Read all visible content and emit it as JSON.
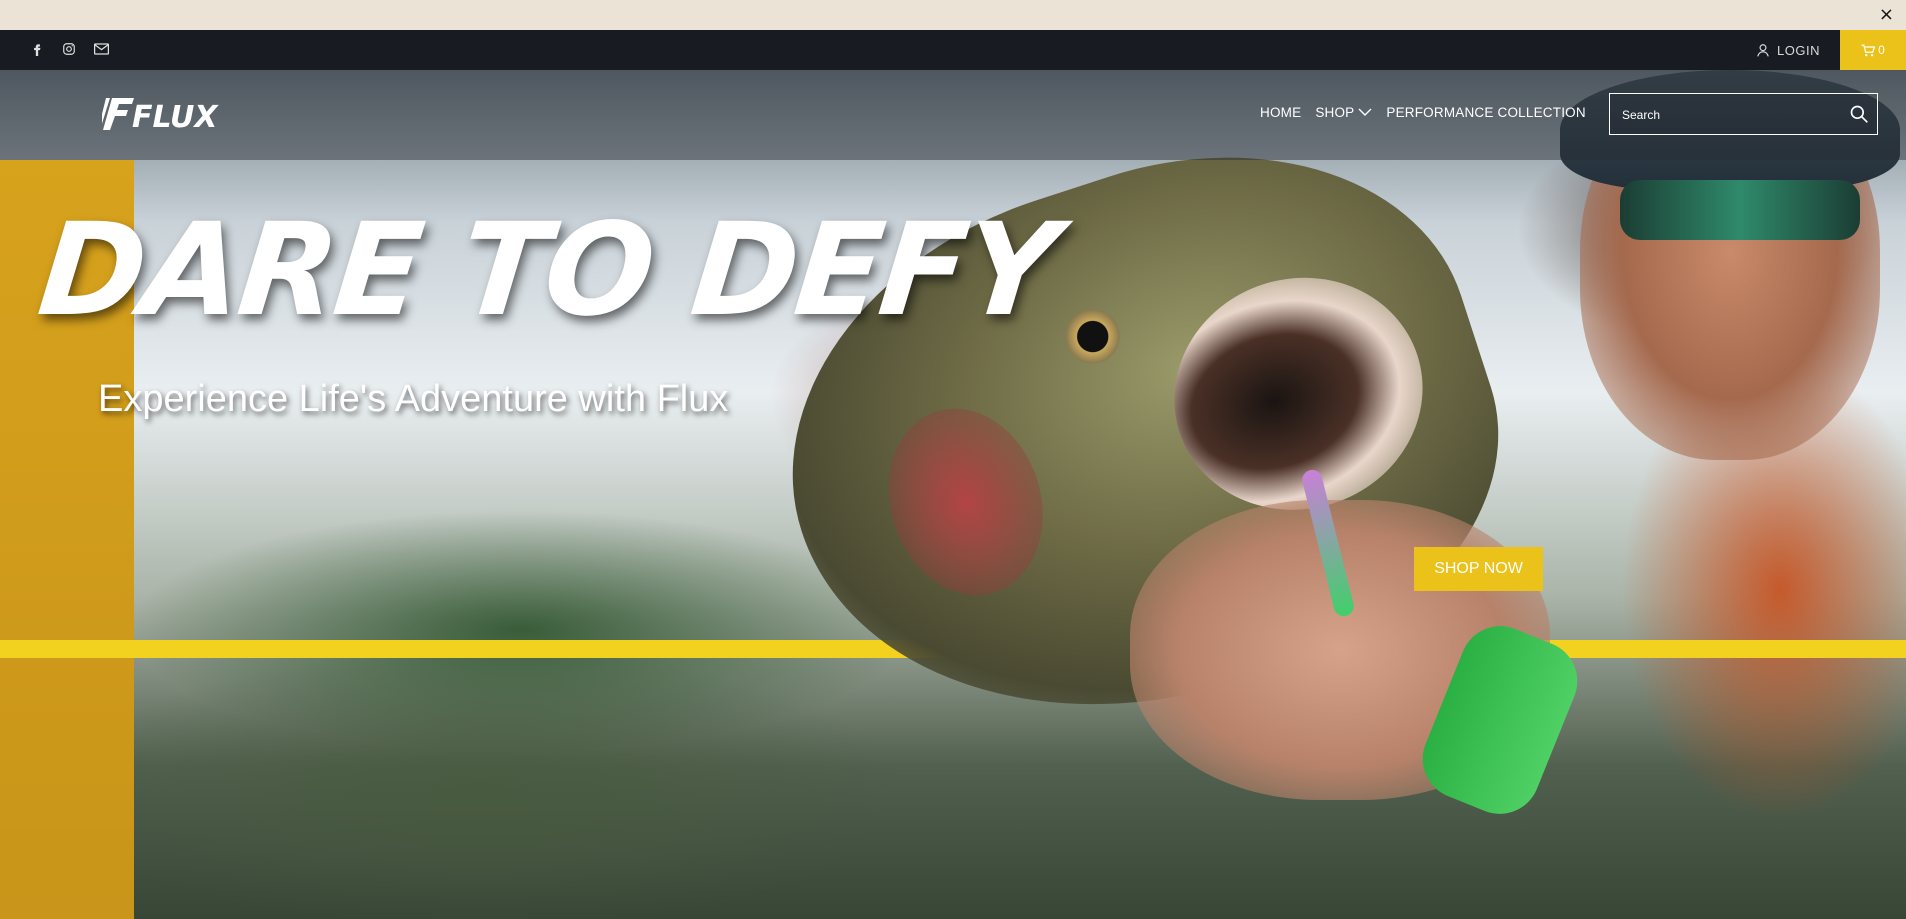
{
  "announcement": {
    "close_label": "×"
  },
  "utility_bar": {
    "social_icons": [
      "facebook-icon",
      "instagram-icon",
      "email-icon"
    ],
    "login_label": "LOGIN",
    "cart_count": "0"
  },
  "header": {
    "logo_text": "FLUX",
    "nav": [
      {
        "label": "HOME"
      },
      {
        "label": "SHOP",
        "has_dropdown": true
      },
      {
        "label": "PERFORMANCE COLLECTION"
      }
    ],
    "search_placeholder": "Search"
  },
  "hero": {
    "headline": "DARE TO DEFY",
    "subheadline": "Experience Life's Adventure with Flux",
    "cta_label": "SHOP NOW"
  },
  "colors": {
    "accent_yellow": "#eac21a",
    "stripe_yellow": "#f2d21e",
    "utility_bar": "#181b21",
    "announcement_bar": "#ebe4d6"
  }
}
